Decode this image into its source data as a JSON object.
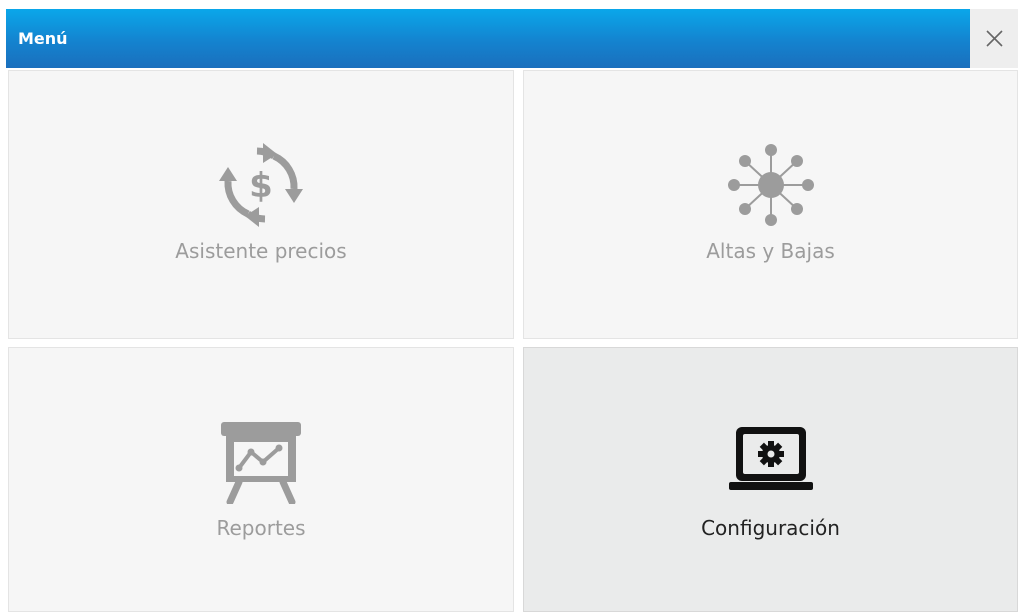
{
  "window": {
    "title": "Menú",
    "close_icon": "close-icon"
  },
  "menu": {
    "items": [
      {
        "label": "Asistente precios",
        "icon": "price-cycle-icon",
        "selected": false
      },
      {
        "label": "Altas y Bajas",
        "icon": "network-hub-icon",
        "selected": false
      },
      {
        "label": "Reportes",
        "icon": "presentation-chart-icon",
        "selected": false
      },
      {
        "label": "Configuración",
        "icon": "laptop-gear-icon",
        "selected": true
      }
    ]
  },
  "colors": {
    "titlebar_top": "#0aa7ea",
    "titlebar_bottom": "#1a6fbd",
    "tile_bg": "#f6f6f6",
    "tile_selected_bg": "#eaebeb",
    "inactive": "#9c9c9c",
    "active": "#111111"
  }
}
